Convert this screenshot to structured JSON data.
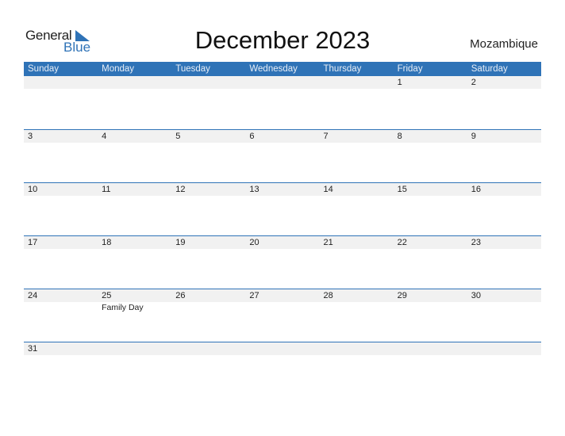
{
  "logo": {
    "text_general": "General",
    "text_blue": "Blue"
  },
  "title": "December 2023",
  "country": "Mozambique",
  "colors": {
    "accent": "#2f73b7",
    "date_strip": "#f1f1f1"
  },
  "weekdays": [
    "Sunday",
    "Monday",
    "Tuesday",
    "Wednesday",
    "Thursday",
    "Friday",
    "Saturday"
  ],
  "weeks": [
    [
      {
        "day": ""
      },
      {
        "day": ""
      },
      {
        "day": ""
      },
      {
        "day": ""
      },
      {
        "day": ""
      },
      {
        "day": "1"
      },
      {
        "day": "2"
      }
    ],
    [
      {
        "day": "3"
      },
      {
        "day": "4"
      },
      {
        "day": "5"
      },
      {
        "day": "6"
      },
      {
        "day": "7"
      },
      {
        "day": "8"
      },
      {
        "day": "9"
      }
    ],
    [
      {
        "day": "10"
      },
      {
        "day": "11"
      },
      {
        "day": "12"
      },
      {
        "day": "13"
      },
      {
        "day": "14"
      },
      {
        "day": "15"
      },
      {
        "day": "16"
      }
    ],
    [
      {
        "day": "17"
      },
      {
        "day": "18"
      },
      {
        "day": "19"
      },
      {
        "day": "20"
      },
      {
        "day": "21"
      },
      {
        "day": "22"
      },
      {
        "day": "23"
      }
    ],
    [
      {
        "day": "24"
      },
      {
        "day": "25",
        "holiday": "Family Day"
      },
      {
        "day": "26"
      },
      {
        "day": "27"
      },
      {
        "day": "28"
      },
      {
        "day": "29"
      },
      {
        "day": "30"
      }
    ],
    [
      {
        "day": "31"
      }
    ]
  ]
}
